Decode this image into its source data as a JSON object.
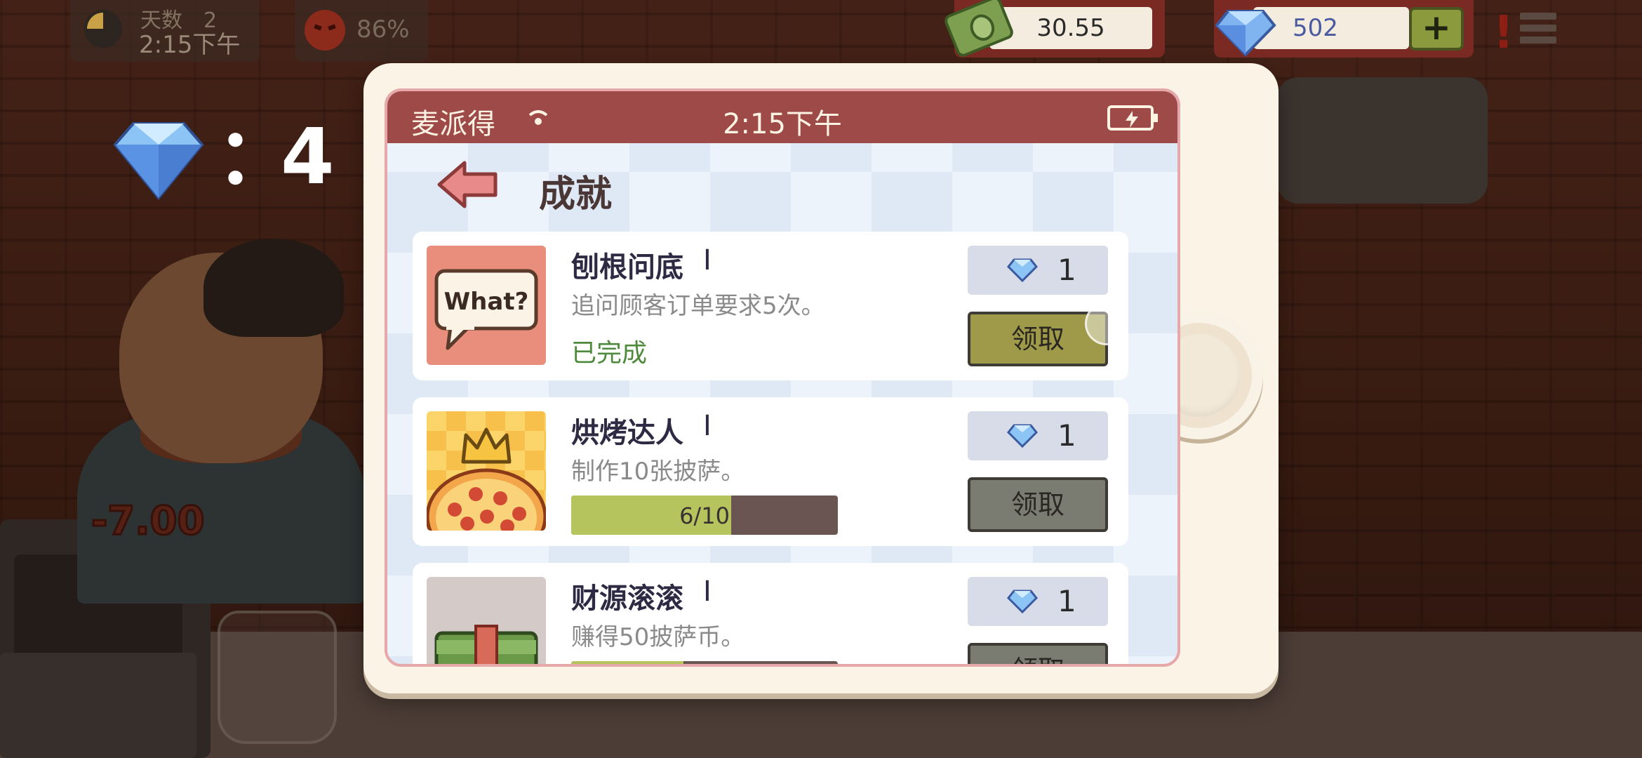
{
  "hud": {
    "day_label": "天数",
    "day_number": "2",
    "time": "2:15下午",
    "mood_percent": "86%",
    "cash": "30.55",
    "gems": "502",
    "plus_label": "+",
    "alert_label": "!"
  },
  "gem_counter": {
    "colon": "：",
    "value": "4"
  },
  "floating_money": "-7.00",
  "phone": {
    "status": {
      "carrier": "麦派得",
      "time": "2:15下午"
    },
    "title": "成就",
    "achievements": [
      {
        "title": "刨根问底",
        "level": "I",
        "description": "追问顾客订单要求5次。",
        "status": "已完成",
        "reward": "1",
        "claim_label": "领取",
        "claimable": true,
        "thumb_text": "What?",
        "icon": "speech-bubble-icon"
      },
      {
        "title": "烘烤达人",
        "level": "I",
        "description": "制作10张披萨。",
        "progress_text": "6/10",
        "progress": 0.6,
        "reward": "1",
        "claim_label": "领取",
        "claimable": false,
        "icon": "pizza-crown-icon"
      },
      {
        "title": "财源滚滚",
        "level": "I",
        "description": "赚得50披萨币。",
        "progress": 0.42,
        "reward": "1",
        "claim_label": "领取",
        "claimable": false,
        "icon": "money-stack-icon"
      }
    ]
  },
  "colors": {
    "status_bar": "#9e4a48",
    "claim_active": "#9e9a4a",
    "claim_disabled": "#7a7c72",
    "progress_fill": "#b6c45e",
    "done_text": "#4d8a3c"
  }
}
